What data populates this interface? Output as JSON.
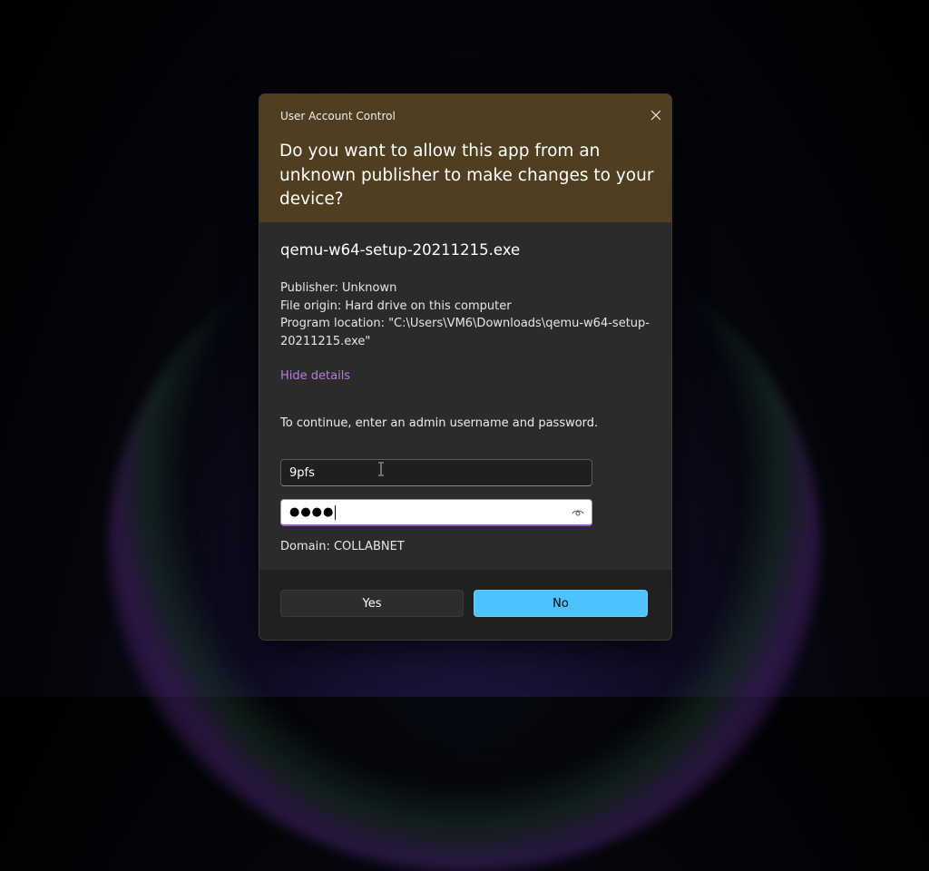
{
  "dialog": {
    "title": "User Account Control",
    "question": "Do you want to allow this app from an unknown publisher to make changes to your device?",
    "app_name": "qemu-w64-setup-20211215.exe",
    "details": {
      "publisher": "Publisher: Unknown",
      "file_origin": "File origin: Hard drive on this computer",
      "program_location": "Program location: \"C:\\Users\\VM6\\Downloads\\qemu-w64-setup-20211215.exe\""
    },
    "hide_details_label": "Hide details",
    "continue_text": "To continue, enter an admin username and password.",
    "username_value": "9pfs",
    "password_value": "●●●●",
    "domain_text": "Domain: COLLABNET",
    "yes_label": "Yes",
    "no_label": "No"
  },
  "colors": {
    "header_bg": "#4f3e20",
    "dialog_bg": "#2b2b2b",
    "footer_bg": "#202020",
    "link": "#b77fe0",
    "accent": "#4cc2ff"
  },
  "icons": {
    "close": "close-icon",
    "reveal": "eye-icon",
    "cursor": "text-cursor-icon"
  }
}
